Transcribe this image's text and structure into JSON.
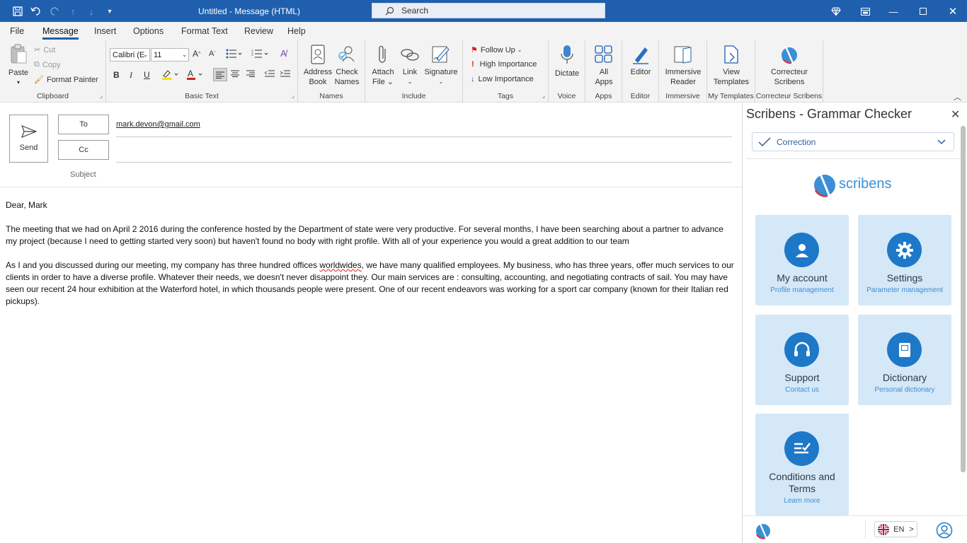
{
  "window": {
    "title": "Untitled  -  Message (HTML)",
    "search_placeholder": "Search"
  },
  "menu": [
    "File",
    "Message",
    "Insert",
    "Options",
    "Format Text",
    "Review",
    "Help"
  ],
  "ribbon": {
    "clipboard": {
      "label": "Clipboard",
      "paste": "Paste",
      "cut": "Cut",
      "copy": "Copy",
      "format_painter": "Format Painter"
    },
    "basic_text": {
      "label": "Basic Text",
      "font": "Calibri (E",
      "size": "11"
    },
    "names": {
      "label": "Names",
      "address_book": [
        "Address",
        "Book"
      ],
      "check_names": [
        "Check",
        "Names"
      ]
    },
    "include": {
      "label": "Include",
      "attach_file": [
        "Attach",
        "File ⌄"
      ],
      "link": "Link",
      "signature": "Signature"
    },
    "tags": {
      "label": "Tags",
      "follow_up": "Follow Up",
      "high_importance": "High Importance",
      "low_importance": "Low Importance"
    },
    "voice": {
      "label": "Voice",
      "dictate": "Dictate"
    },
    "apps": {
      "label": "Apps",
      "all_apps": [
        "All",
        "Apps"
      ]
    },
    "editor": {
      "label": "Editor",
      "editor": "Editor"
    },
    "immersive": {
      "label": "Immersive",
      "reader": [
        "Immersive",
        "Reader"
      ]
    },
    "templates": {
      "label": "My Templates",
      "view": [
        "View",
        "Templates"
      ]
    },
    "scribens": {
      "label": "Correcteur Scribens",
      "btn": [
        "Correcteur",
        "Scribens"
      ]
    }
  },
  "compose": {
    "send": "Send",
    "to_label": "To",
    "cc_label": "Cc",
    "subject_label": "Subject",
    "to_value": "mark.devon@gmail.com",
    "body": {
      "greeting": "Dear, Mark",
      "p1": "The meeting that we had on April 2 2016 during the conference hosted by the Department of state were very productive. For several months, I have been searching about a partner to advance my project (because I need to getting started very soon) but haven't found no body with right profile. With all of your experience you would a great addition to our team",
      "p2a": "As I and you discussed during our meeting, my company has three hundred offices ",
      "p2_err": "worldwides",
      "p2b": ", we have many qualified employees. My business, who has three years, offer much services to our clients in order to have a diverse profile. Whatever their needs, we doesn't never disappoint they. Our main services are : consulting, accounting, and negotiating contracts of sail. You may have seen our recent 24 hour exhibition at the Waterford hotel, in which thousands people were present. One of our recent endeavors was working for a sport car company (known for their Italian red pickups)."
    }
  },
  "panel": {
    "title": "Scribens - Grammar Checker",
    "mode": "Correction",
    "logo_text": "scribens",
    "tiles": [
      {
        "title": "My account",
        "sub": "Profile management"
      },
      {
        "title": "Settings",
        "sub": "Parameter management"
      },
      {
        "title": "Support",
        "sub": "Contact us"
      },
      {
        "title": "Dictionary",
        "sub": "Personal dictionary"
      },
      {
        "title": "Conditions and Terms",
        "sub": "Learn more"
      }
    ],
    "lang": "EN"
  },
  "colors": {
    "titlebar": "#1f5fae",
    "accent": "#1e78c8",
    "tile_bg": "#d5e8f7"
  }
}
